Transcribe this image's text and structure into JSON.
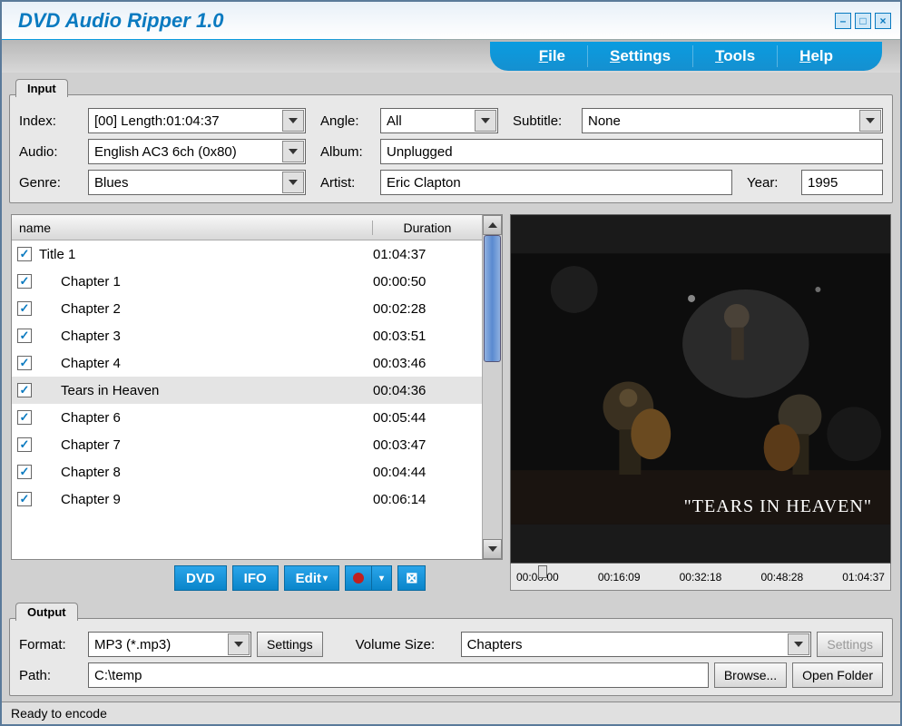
{
  "app": {
    "title": "DVD Audio Ripper 1.0"
  },
  "menu": {
    "file": "File",
    "settings": "Settings",
    "tools": "Tools",
    "help": "Help"
  },
  "input": {
    "tab": "Input",
    "labels": {
      "index": "Index:",
      "angle": "Angle:",
      "subtitle": "Subtitle:",
      "audio": "Audio:",
      "album": "Album:",
      "genre": "Genre:",
      "artist": "Artist:",
      "year": "Year:"
    },
    "index": "[00] Length:01:04:37",
    "angle": "All",
    "subtitle": "None",
    "audio": "English AC3 6ch (0x80)",
    "album": "Unplugged",
    "genre": "Blues",
    "artist": "Eric Clapton",
    "year": "1995"
  },
  "list": {
    "cols": {
      "name": "name",
      "duration": "Duration"
    },
    "rows": [
      {
        "name": "Title 1",
        "duration": "01:04:37",
        "indent": false,
        "selected": false
      },
      {
        "name": "Chapter 1",
        "duration": "00:00:50",
        "indent": true,
        "selected": false
      },
      {
        "name": "Chapter 2",
        "duration": "00:02:28",
        "indent": true,
        "selected": false
      },
      {
        "name": "Chapter 3",
        "duration": "00:03:51",
        "indent": true,
        "selected": false
      },
      {
        "name": "Chapter 4",
        "duration": "00:03:46",
        "indent": true,
        "selected": false
      },
      {
        "name": "Tears in Heaven",
        "duration": "00:04:36",
        "indent": true,
        "selected": true
      },
      {
        "name": "Chapter 6",
        "duration": "00:05:44",
        "indent": true,
        "selected": false
      },
      {
        "name": "Chapter 7",
        "duration": "00:03:47",
        "indent": true,
        "selected": false
      },
      {
        "name": "Chapter 8",
        "duration": "00:04:44",
        "indent": true,
        "selected": false
      },
      {
        "name": "Chapter 9",
        "duration": "00:06:14",
        "indent": true,
        "selected": false
      }
    ]
  },
  "toolbar": {
    "dvd": "DVD",
    "ifo": "IFO",
    "edit": "Edit"
  },
  "preview": {
    "overlay": "\"TEARS IN HEAVEN\"",
    "timeline": [
      "00:00:00",
      "00:16:09",
      "00:32:18",
      "00:48:28",
      "01:04:37"
    ]
  },
  "output": {
    "tab": "Output",
    "labels": {
      "format": "Format:",
      "volume": "Volume Size:",
      "path": "Path:"
    },
    "format": "MP3 (*.mp3)",
    "settings": "Settings",
    "volume": "Chapters",
    "settings2": "Settings",
    "path": "C:\\temp",
    "browse": "Browse...",
    "open": "Open Folder"
  },
  "status": "Ready to encode"
}
